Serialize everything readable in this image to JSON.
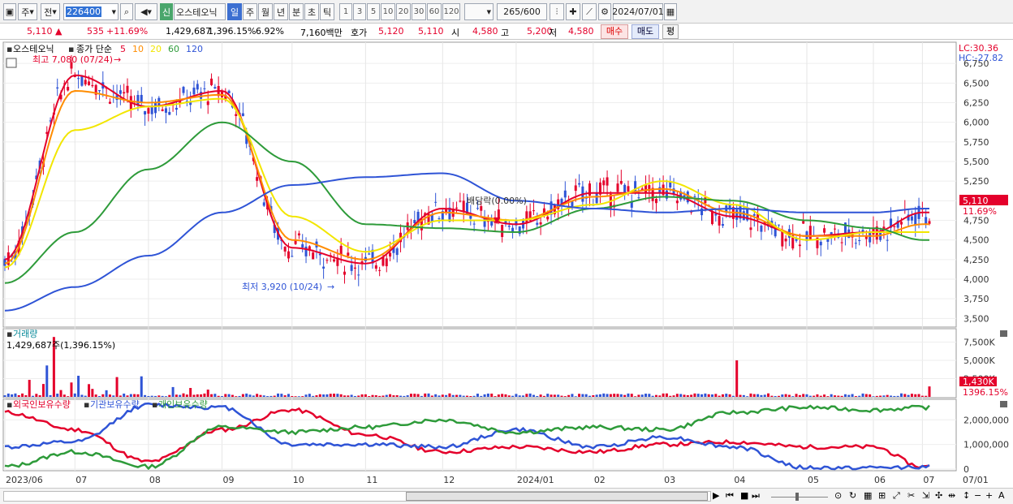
{
  "toolbar": {
    "period_selector": "주",
    "prev_label": "전",
    "stock_code": "226400",
    "sin_badge": "신",
    "stock_name": "오스테오닉",
    "period_tabs": [
      "일",
      "주",
      "월",
      "년",
      "분",
      "초",
      "틱"
    ],
    "active_period": "일",
    "interval_buttons": [
      "1",
      "3",
      "5",
      "10",
      "20",
      "30",
      "60",
      "120"
    ],
    "count_value": "265",
    "count_total": "/600",
    "date_value": "2024/07/01"
  },
  "info": {
    "price": "5,110",
    "change": "535",
    "change_pct": "+11.69%",
    "volume": "1,429,687",
    "volume_pct": "1,396.15%",
    "turnover_pct": "6.92%",
    "amount": "7,160백만",
    "quote_label": "호가",
    "ask": "5,120",
    "bid": "5,110",
    "open_label": "시",
    "open": "4,580",
    "high_label": "고",
    "high": "5,200",
    "low_label": "저",
    "low": "4,580",
    "buy_label": "매수",
    "sell_label": "매도",
    "avg_label": "평"
  },
  "price_panel": {
    "legend_name": "오스테오닉",
    "legend_ma_label": "종가 단순",
    "ma_periods": [
      "5",
      "10",
      "20",
      "60",
      "120"
    ],
    "ma_colors": [
      "#e4002b",
      "#ff8c00",
      "#f2e600",
      "#2e9b3a",
      "#2f54d6"
    ],
    "lc": "LC:30.36",
    "hc": "HC:-27.82",
    "high_annot": "최고 7,080 (07/24)",
    "low_annot": "최저 3,920 (10/24)",
    "dividend_annot": "배당락(0.00%)",
    "current_price_tag": "5,110",
    "current_pct_tag": "11.69%",
    "y_ticks": [
      "6,750",
      "6,500",
      "6,250",
      "6,000",
      "5,750",
      "5,500",
      "5,250",
      "5,000",
      "4,750",
      "4,500",
      "4,250",
      "4,000",
      "3,750",
      "3,500"
    ]
  },
  "volume_panel": {
    "title": "거래량",
    "info": "1,429,687주(1,396.15%)",
    "y_ticks": [
      "7,500K",
      "5,000K",
      "2,500K"
    ],
    "current_tag": "1,430K",
    "current_pct": "1396.15%"
  },
  "holding_panel": {
    "series_labels": [
      "외국인보유수량",
      "기관보유수량",
      "개인보유수량"
    ],
    "series_colors": [
      "#e4002b",
      "#2f54d6",
      "#2e9b3a"
    ],
    "y_ticks": [
      "2,000,000",
      "1,000,000",
      "0"
    ]
  },
  "x_axis": [
    "2023/06",
    "07",
    "08",
    "09",
    "10",
    "11",
    "12",
    "2024/01",
    "02",
    "03",
    "04",
    "05",
    "06",
    "07",
    "07/01"
  ],
  "chart_data": {
    "type": "line",
    "x": [
      "2023/06",
      "07",
      "08",
      "09",
      "10",
      "11",
      "12",
      "2024/01",
      "02",
      "03",
      "04",
      "05",
      "06",
      "07"
    ],
    "series": [
      {
        "name": "5",
        "values": [
          4250,
          6600,
          6200,
          6400,
          4400,
          4200,
          4900,
          4700,
          5100,
          5100,
          4800,
          4550,
          4600,
          4850
        ]
      },
      {
        "name": "10",
        "values": [
          4200,
          6400,
          6250,
          6350,
          4500,
          4250,
          4850,
          4750,
          5050,
          5150,
          4850,
          4550,
          4550,
          4700
        ]
      },
      {
        "name": "20",
        "values": [
          4150,
          5900,
          6200,
          6300,
          4800,
          4350,
          4750,
          4750,
          4950,
          5250,
          4950,
          4500,
          4600,
          4600
        ]
      },
      {
        "name": "60",
        "values": [
          3950,
          4600,
          5400,
          6000,
          5500,
          4700,
          4650,
          4600,
          4900,
          5050,
          5000,
          4750,
          4650,
          4500
        ]
      },
      {
        "name": "120",
        "values": [
          3600,
          3900,
          4300,
          4850,
          5200,
          5300,
          5350,
          5000,
          4900,
          4850,
          4900,
          4850,
          4850,
          4900
        ]
      }
    ],
    "ylim": [
      3400,
      7000
    ]
  }
}
